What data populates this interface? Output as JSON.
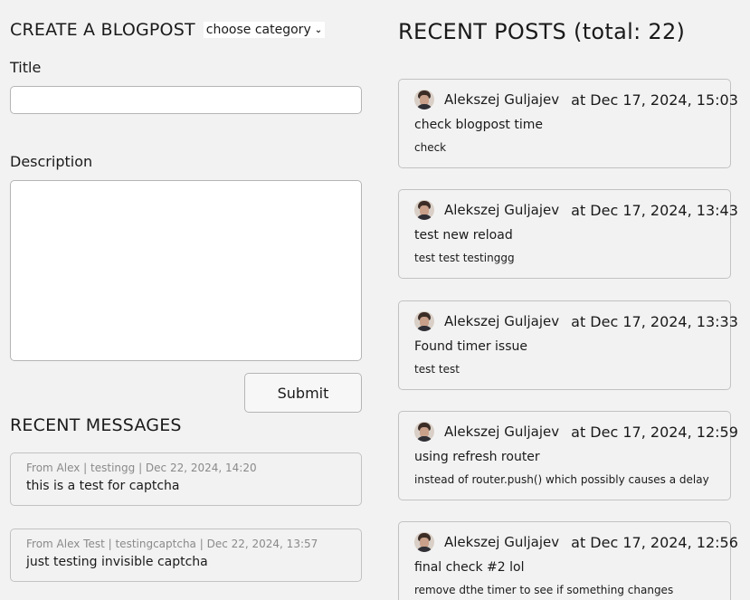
{
  "create": {
    "heading": "CREATE A BLOGPOST",
    "category_selected": "choose category",
    "title_label": "Title",
    "title_value": "",
    "description_label": "Description",
    "description_value": "",
    "submit_label": "Submit"
  },
  "messages": {
    "heading": "RECENT MESSAGES",
    "items": [
      {
        "meta": "From Alex | testingg | Dec 22, 2024, 14:20",
        "text": "this is a test for captcha"
      },
      {
        "meta": "From Alex Test | testingcaptcha | Dec 22, 2024, 13:57",
        "text": "just testing invisible captcha"
      }
    ]
  },
  "posts": {
    "heading": "RECENT POSTS (total: 22)",
    "items": [
      {
        "author": "Alekszej Guljajev",
        "date": "at Dec 17, 2024, 15:03",
        "title": "check blogpost time",
        "description": "check"
      },
      {
        "author": "Alekszej Guljajev",
        "date": "at Dec 17, 2024, 13:43",
        "title": "test new reload",
        "description": "test test testinggg"
      },
      {
        "author": "Alekszej Guljajev",
        "date": "at Dec 17, 2024, 13:33",
        "title": "Found timer issue",
        "description": "test test"
      },
      {
        "author": "Alekszej Guljajev",
        "date": "at Dec 17, 2024, 12:59",
        "title": "using refresh router",
        "description": "instead of router.push() which possibly causes a delay"
      },
      {
        "author": "Alekszej Guljajev",
        "date": "at Dec 17, 2024, 12:56",
        "title": "final check #2 lol",
        "description": "remove dthe timer to see if something changes"
      }
    ]
  },
  "icons": {
    "chevron": "chevron-down-icon",
    "avatar": "author-avatar"
  }
}
